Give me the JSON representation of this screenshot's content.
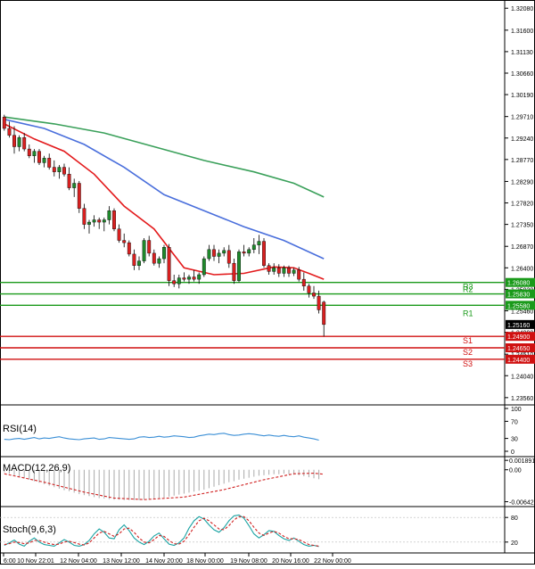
{
  "colors": {
    "bull": "#1f8a2c",
    "bear": "#d92020",
    "ma_short": "#e31a1c",
    "ma_mid": "#4a6fdc",
    "ma_long": "#3aa05a",
    "resistance": "#1a9a1a",
    "support": "#d01010",
    "rsi": "#3b8fd6",
    "macd_signal": "#d02020",
    "stoch_k": "#1aa3a3",
    "stoch_d": "#d02020"
  },
  "chart_data": [
    {
      "type": "candlestick",
      "ylim": [
        1.2344,
        1.3226
      ],
      "price_ticks": [
        "1.32080",
        "1.31600",
        "1.31130",
        "1.30660",
        "1.30190",
        "1.29710",
        "1.29240",
        "1.28770",
        "1.28290",
        "1.27820",
        "1.27350",
        "1.26870",
        "1.26400",
        "1.25930",
        "1.25460",
        "1.24990",
        "1.24510",
        "1.24040",
        "1.23560"
      ],
      "x_labels": [
        "6:00",
        "10 Nov 22:01",
        "12 Nov 04:00",
        "13 Nov 12:00",
        "14 Nov 20:00",
        "18 Nov 00:00",
        "19 Nov 08:00",
        "20 Nov 16:00",
        "22 Nov 00:00"
      ],
      "candles": [
        [
          1.297,
          1.2975,
          1.294,
          1.2945
        ],
        [
          1.2945,
          1.296,
          1.2925,
          1.293
        ],
        [
          1.293,
          1.295,
          1.289,
          1.2905
        ],
        [
          1.2905,
          1.293,
          1.2895,
          1.2925
        ],
        [
          1.2925,
          1.2935,
          1.2895,
          1.29
        ],
        [
          1.29,
          1.291,
          1.288,
          1.2885
        ],
        [
          1.2885,
          1.29,
          1.287,
          1.2895
        ],
        [
          1.2895,
          1.29,
          1.2865,
          1.287
        ],
        [
          1.287,
          1.2885,
          1.286,
          1.288
        ],
        [
          1.288,
          1.289,
          1.2855,
          1.286
        ],
        [
          1.286,
          1.2875,
          1.284,
          1.285
        ],
        [
          1.285,
          1.2865,
          1.2835,
          1.286
        ],
        [
          1.286,
          1.2868,
          1.284,
          1.2845
        ],
        [
          1.2845,
          1.286,
          1.281,
          1.2815
        ],
        [
          1.2815,
          1.2835,
          1.2795,
          1.2825
        ],
        [
          1.2825,
          1.283,
          1.276,
          1.277
        ],
        [
          1.277,
          1.278,
          1.2725,
          1.2735
        ],
        [
          1.2735,
          1.2745,
          1.2715,
          1.274
        ],
        [
          1.274,
          1.2755,
          1.273,
          1.2745
        ],
        [
          1.2745,
          1.275,
          1.2725,
          1.274
        ],
        [
          1.274,
          1.275,
          1.272,
          1.2745
        ],
        [
          1.2745,
          1.2775,
          1.2735,
          1.2765
        ],
        [
          1.2765,
          1.277,
          1.272,
          1.2725
        ],
        [
          1.2725,
          1.2735,
          1.2695,
          1.27
        ],
        [
          1.27,
          1.2715,
          1.2685,
          1.2695
        ],
        [
          1.2695,
          1.27,
          1.2665,
          1.267
        ],
        [
          1.267,
          1.268,
          1.2635,
          1.2645
        ],
        [
          1.2645,
          1.2665,
          1.2635,
          1.2655
        ],
        [
          1.2655,
          1.2705,
          1.265,
          1.27
        ],
        [
          1.27,
          1.271,
          1.2665,
          1.2672
        ],
        [
          1.2672,
          1.268,
          1.2645,
          1.265
        ],
        [
          1.265,
          1.2665,
          1.264,
          1.266
        ],
        [
          1.266,
          1.269,
          1.265,
          1.2685
        ],
        [
          1.2685,
          1.2692,
          1.26,
          1.2612
        ],
        [
          1.2612,
          1.2625,
          1.2598,
          1.2605
        ],
        [
          1.2605,
          1.2625,
          1.2595,
          1.2618
        ],
        [
          1.2618,
          1.263,
          1.261,
          1.2615
        ],
        [
          1.2615,
          1.2625,
          1.2605,
          1.262
        ],
        [
          1.262,
          1.2635,
          1.261,
          1.2615
        ],
        [
          1.2615,
          1.263,
          1.2605,
          1.2625
        ],
        [
          1.2625,
          1.2665,
          1.262,
          1.266
        ],
        [
          1.266,
          1.269,
          1.2655,
          1.268
        ],
        [
          1.268,
          1.269,
          1.2655,
          1.2665
        ],
        [
          1.2665,
          1.268,
          1.265,
          1.2672
        ],
        [
          1.2672,
          1.2685,
          1.2665,
          1.2678
        ],
        [
          1.2678,
          1.269,
          1.264,
          1.265
        ],
        [
          1.265,
          1.266,
          1.2605,
          1.2612
        ],
        [
          1.2612,
          1.268,
          1.2608,
          1.2675
        ],
        [
          1.2675,
          1.269,
          1.2665,
          1.2672
        ],
        [
          1.2672,
          1.2685,
          1.2665,
          1.268
        ],
        [
          1.268,
          1.2705,
          1.2672,
          1.269
        ],
        [
          1.269,
          1.2712,
          1.267,
          1.2698
        ],
        [
          1.2698,
          1.2705,
          1.264,
          1.2645
        ],
        [
          1.2645,
          1.265,
          1.2625,
          1.2632
        ],
        [
          1.2632,
          1.265,
          1.2625,
          1.264
        ],
        [
          1.264,
          1.2648,
          1.262,
          1.2628
        ],
        [
          1.2628,
          1.2645,
          1.262,
          1.264
        ],
        [
          1.264,
          1.2645,
          1.262,
          1.2628
        ],
        [
          1.2628,
          1.264,
          1.2622,
          1.2635
        ],
        [
          1.2635,
          1.2642,
          1.261,
          1.2615
        ],
        [
          1.2615,
          1.263,
          1.259,
          1.26
        ],
        [
          1.26,
          1.2605,
          1.2575,
          1.2585
        ],
        [
          1.2585,
          1.26,
          1.2572,
          1.2578
        ],
        [
          1.2578,
          1.259,
          1.254,
          1.2548
        ],
        [
          1.2565,
          1.2568,
          1.249,
          1.2516
        ]
      ],
      "ma_short": [
        [
          0,
          1.2955
        ],
        [
          6,
          1.2922
        ],
        [
          12,
          1.2895
        ],
        [
          18,
          1.2845
        ],
        [
          24,
          1.2775
        ],
        [
          30,
          1.2725
        ],
        [
          36,
          1.264
        ],
        [
          42,
          1.2625
        ],
        [
          48,
          1.2628
        ],
        [
          54,
          1.2642
        ],
        [
          58,
          1.264
        ],
        [
          61,
          1.2628
        ],
        [
          64,
          1.2615
        ]
      ],
      "ma_mid": [
        [
          0,
          1.2965
        ],
        [
          8,
          1.2945
        ],
        [
          16,
          1.291
        ],
        [
          24,
          1.286
        ],
        [
          32,
          1.28
        ],
        [
          40,
          1.2765
        ],
        [
          48,
          1.273
        ],
        [
          56,
          1.27
        ],
        [
          64,
          1.266
        ]
      ],
      "ma_long": [
        [
          0,
          1.297
        ],
        [
          10,
          1.2955
        ],
        [
          20,
          1.2935
        ],
        [
          30,
          1.2905
        ],
        [
          40,
          1.2875
        ],
        [
          50,
          1.285
        ],
        [
          58,
          1.2825
        ],
        [
          64,
          1.2795
        ]
      ],
      "levels": [
        {
          "name": "R3",
          "value": 1.2608,
          "kind": "resistance",
          "tag": "1.26080"
        },
        {
          "name": "R2",
          "value": 1.2583,
          "kind": "resistance",
          "tag": "1.25830"
        },
        {
          "name": "R1",
          "value": 1.2558,
          "kind": "resistance",
          "tag": "1.25580"
        },
        {
          "name": "S1",
          "value": 1.249,
          "kind": "support",
          "tag": "1.24900"
        },
        {
          "name": "S2",
          "value": 1.2465,
          "kind": "support",
          "tag": "1.24650"
        },
        {
          "name": "S3",
          "value": 1.244,
          "kind": "support",
          "tag": "1.24400"
        }
      ],
      "last_price": {
        "value": 1.2516,
        "tag": "1.25160"
      }
    },
    {
      "type": "line",
      "title": "RSI(14)",
      "ylim": [
        0,
        100
      ],
      "ticks": [
        "100",
        "70",
        "30",
        "0"
      ],
      "values": [
        28,
        27,
        29,
        30,
        28,
        30,
        32,
        29,
        31,
        30,
        32,
        34,
        31,
        29,
        28,
        27,
        29,
        30,
        31,
        28,
        29,
        32,
        31,
        30,
        29,
        28,
        29,
        33,
        34,
        32,
        33,
        35,
        33,
        34,
        36,
        35,
        34,
        32,
        33,
        36,
        38,
        40,
        39,
        41,
        42,
        39,
        37,
        38,
        40,
        41,
        40,
        38,
        36,
        38,
        36,
        35,
        37,
        35,
        34,
        36,
        33,
        31,
        29,
        26
      ]
    },
    {
      "type": "bar",
      "title": "MACD(12,26,9)",
      "ylim": [
        -0.0065,
        0.0021
      ],
      "ticks": [
        "0.001891",
        "0.00",
        "-0.006422"
      ],
      "histogram": [
        -0.0005,
        -0.0008,
        -0.0011,
        -0.0014,
        -0.0017,
        -0.002,
        -0.0023,
        -0.0026,
        -0.0029,
        -0.0032,
        -0.0035,
        -0.0038,
        -0.0041,
        -0.0043,
        -0.0046,
        -0.0049,
        -0.0051,
        -0.0053,
        -0.0055,
        -0.0057,
        -0.0058,
        -0.0059,
        -0.006,
        -0.006,
        -0.0061,
        -0.0061,
        -0.0061,
        -0.0061,
        -0.006,
        -0.0059,
        -0.0058,
        -0.0057,
        -0.0056,
        -0.0054,
        -0.0052,
        -0.005,
        -0.0048,
        -0.0046,
        -0.0044,
        -0.0042,
        -0.004,
        -0.0037,
        -0.0034,
        -0.0031,
        -0.0028,
        -0.0025,
        -0.0023,
        -0.002,
        -0.0018,
        -0.0016,
        -0.0014,
        -0.0012,
        -0.0011,
        -0.001,
        -0.0009,
        -0.0009,
        -0.0008,
        -0.0009,
        -0.001,
        -0.0011,
        -0.0013,
        -0.0015,
        -0.0017,
        -0.0019
      ],
      "signal": [
        [
          0,
          -0.0008
        ],
        [
          8,
          -0.0025
        ],
        [
          16,
          -0.0045
        ],
        [
          22,
          -0.0057
        ],
        [
          28,
          -0.006
        ],
        [
          36,
          -0.0055
        ],
        [
          44,
          -0.004
        ],
        [
          52,
          -0.002
        ],
        [
          58,
          -0.0008
        ],
        [
          62,
          -0.0007
        ],
        [
          64,
          -0.0009
        ]
      ]
    },
    {
      "type": "line",
      "title": "Stoch(9,6,3)",
      "ylim": [
        0,
        100
      ],
      "ticks": [
        "80",
        "20"
      ],
      "k": [
        12,
        18,
        25,
        15,
        10,
        22,
        30,
        20,
        14,
        12,
        10,
        18,
        26,
        20,
        12,
        10,
        14,
        24,
        40,
        52,
        44,
        30,
        28,
        50,
        62,
        48,
        30,
        20,
        14,
        22,
        35,
        42,
        28,
        15,
        12,
        18,
        30,
        54,
        72,
        82,
        76,
        62,
        50,
        44,
        55,
        72,
        84,
        86,
        78,
        60,
        40,
        30,
        38,
        48,
        46,
        36,
        28,
        24,
        30,
        22,
        14,
        10,
        12,
        9
      ],
      "d": [
        14,
        16,
        20,
        19,
        16,
        18,
        24,
        24,
        20,
        16,
        14,
        15,
        20,
        22,
        19,
        15,
        13,
        18,
        30,
        42,
        46,
        40,
        34,
        40,
        52,
        54,
        44,
        30,
        20,
        18,
        26,
        36,
        34,
        24,
        16,
        15,
        22,
        38,
        56,
        72,
        78,
        72,
        62,
        52,
        50,
        60,
        74,
        82,
        82,
        72,
        56,
        42,
        36,
        42,
        46,
        42,
        34,
        28,
        28,
        26,
        20,
        14,
        12,
        10
      ]
    }
  ]
}
